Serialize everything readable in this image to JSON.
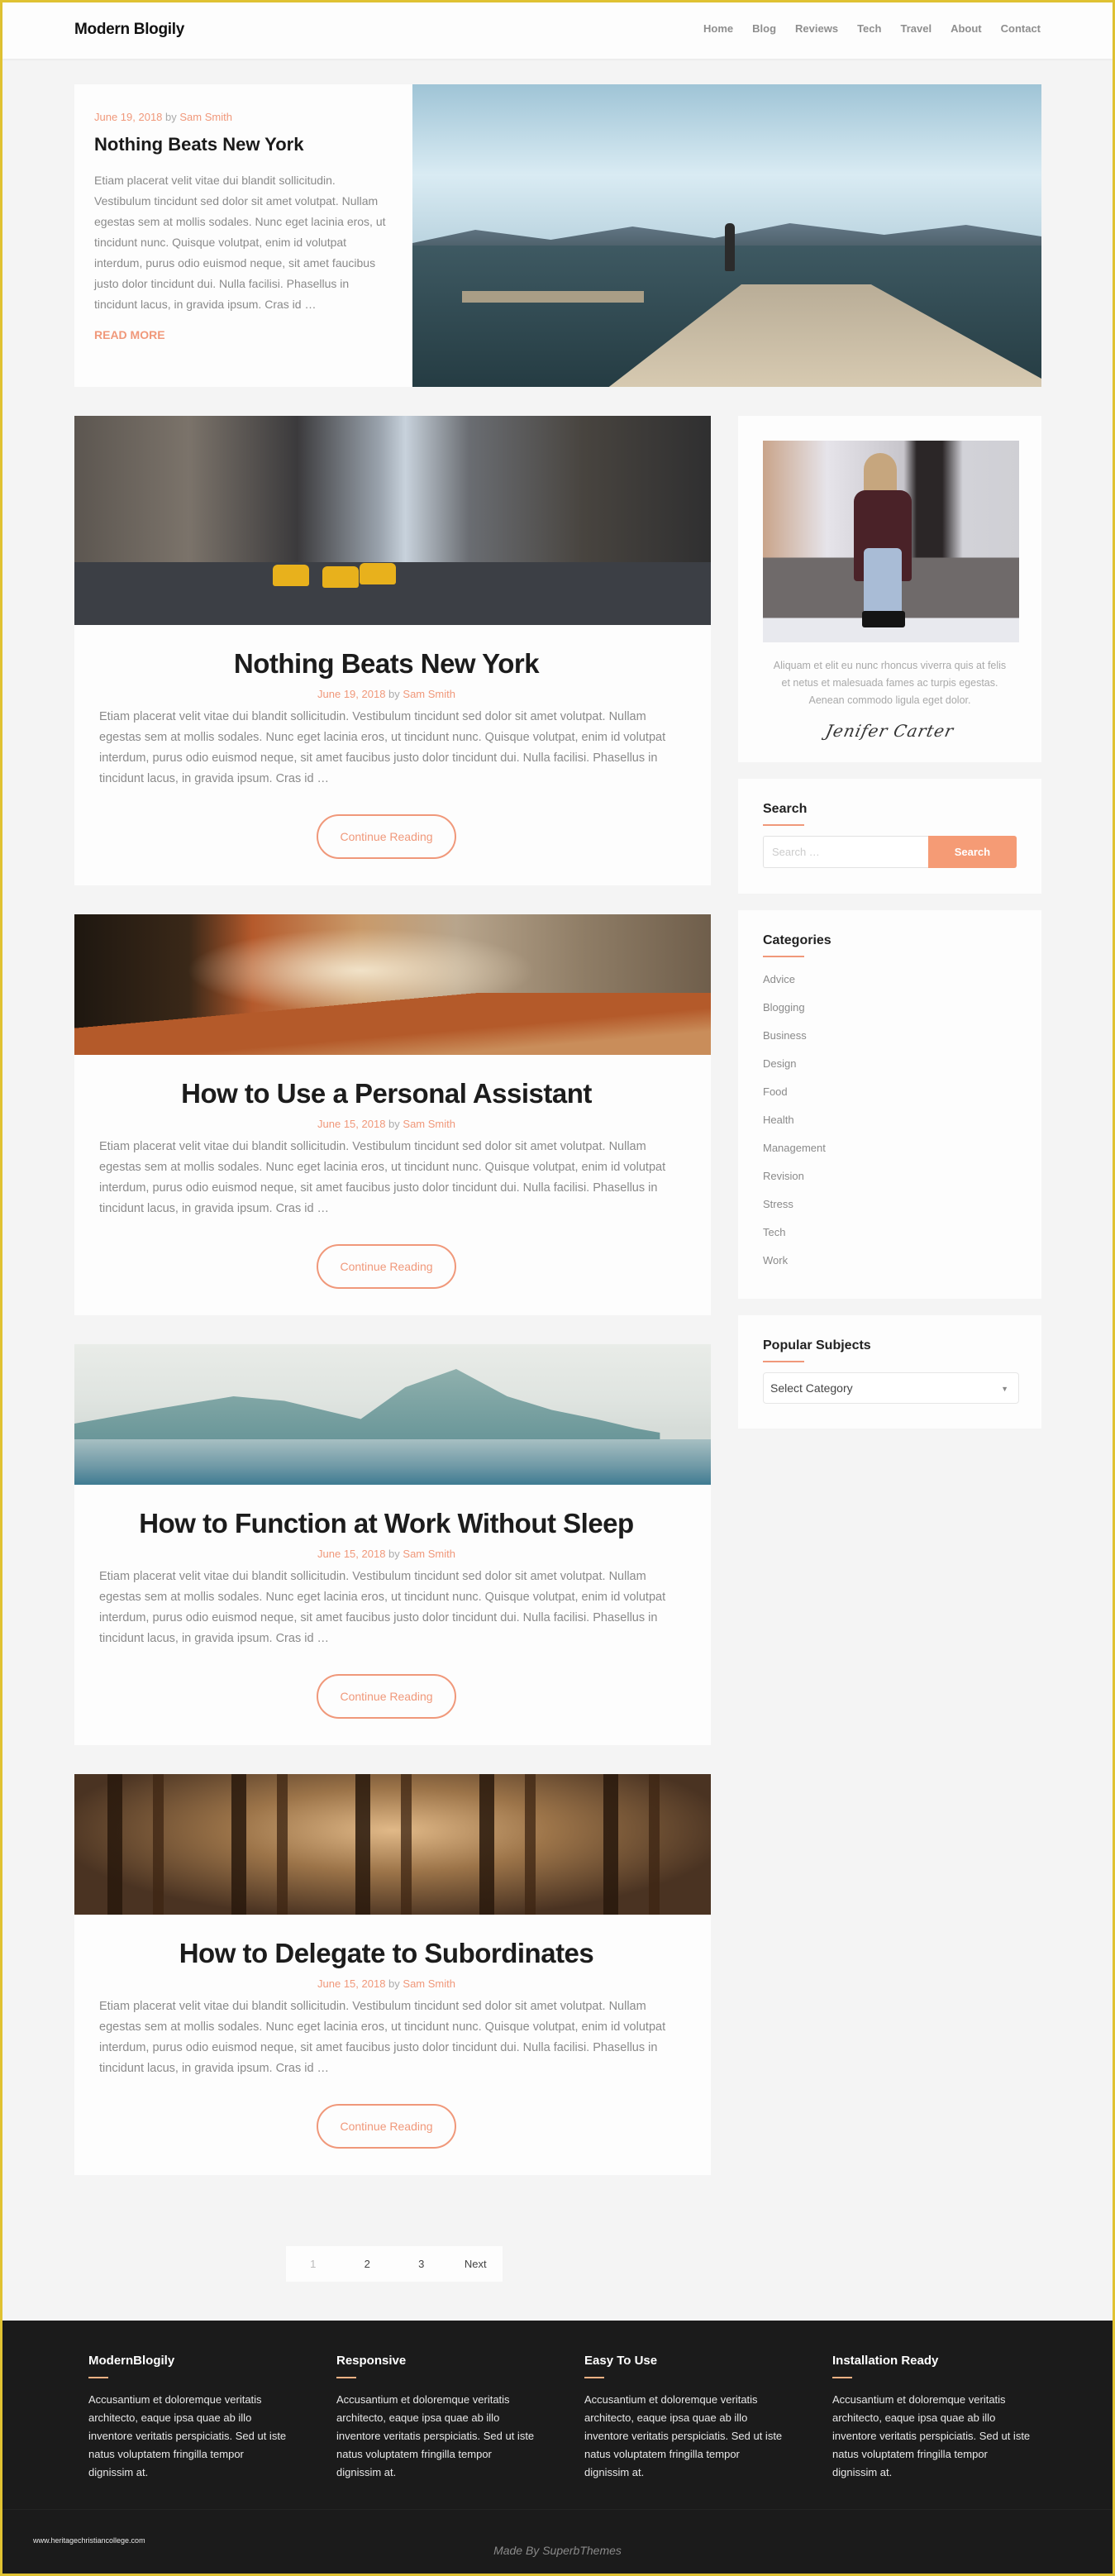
{
  "header": {
    "site_title": "Modern Blogily",
    "nav": [
      "Home",
      "Blog",
      "Reviews",
      "Tech",
      "Travel",
      "About",
      "Contact"
    ]
  },
  "featured": {
    "date": "June 19, 2018",
    "by": "by",
    "author": "Sam Smith",
    "title": "Nothing Beats New York",
    "excerpt": "Etiam placerat velit vitae dui blandit sollicitudin. Vestibulum tincidunt sed dolor sit amet volutpat. Nullam egestas sem at mollis sodales. Nunc eget lacinia eros, ut tincidunt nunc. Quisque volutpat, enim id volutpat interdum, purus odio euismod neque, sit amet faucibus justo dolor tincidunt dui. Nulla facilisi. Phasellus in tincidunt lacus, in gravida ipsum. Cras id …",
    "read_more": "READ MORE",
    "image": "lake-dock-photo"
  },
  "posts": [
    {
      "image": "city-street-photo",
      "title": "Nothing Beats New York",
      "date": "June 19, 2018",
      "by": "by",
      "author": "Sam Smith",
      "excerpt": "Etiam placerat velit vitae dui blandit sollicitudin. Vestibulum tincidunt sed dolor sit amet volutpat. Nullam egestas sem at mollis sodales. Nunc eget lacinia eros, ut tincidunt nunc. Quisque volutpat, enim id volutpat interdum, purus odio euismod neque, sit amet faucibus justo dolor tincidunt dui. Nulla facilisi. Phasellus in tincidunt lacus, in gravida ipsum. Cras id …",
      "button": "Continue Reading"
    },
    {
      "image": "autumn-forest-photo",
      "title": "How to Use a Personal Assistant",
      "date": "June 15, 2018",
      "by": "by",
      "author": "Sam Smith",
      "excerpt": "Etiam placerat velit vitae dui blandit sollicitudin. Vestibulum tincidunt sed dolor sit amet volutpat. Nullam egestas sem at mollis sodales. Nunc eget lacinia eros, ut tincidunt nunc. Quisque volutpat, enim id volutpat interdum, purus odio euismod neque, sit amet faucibus justo dolor tincidunt dui. Nulla facilisi. Phasellus in tincidunt lacus, in gravida ipsum. Cras id …",
      "button": "Continue Reading"
    },
    {
      "image": "coastal-mountains-photo",
      "title": "How to Function at Work Without Sleep",
      "date": "June 15, 2018",
      "by": "by",
      "author": "Sam Smith",
      "excerpt": "Etiam placerat velit vitae dui blandit sollicitudin. Vestibulum tincidunt sed dolor sit amet volutpat. Nullam egestas sem at mollis sodales. Nunc eget lacinia eros, ut tincidunt nunc. Quisque volutpat, enim id volutpat interdum, purus odio euismod neque, sit amet faucibus justo dolor tincidunt dui. Nulla facilisi. Phasellus in tincidunt lacus, in gravida ipsum. Cras id …",
      "button": "Continue Reading"
    },
    {
      "image": "redwood-forest-photo",
      "title": "How to Delegate to Subordinates",
      "date": "June 15, 2018",
      "by": "by",
      "author": "Sam Smith",
      "excerpt": "Etiam placerat velit vitae dui blandit sollicitudin. Vestibulum tincidunt sed dolor sit amet volutpat. Nullam egestas sem at mollis sodales. Nunc eget lacinia eros, ut tincidunt nunc. Quisque volutpat, enim id volutpat interdum, purus odio euismod neque, sit amet faucibus justo dolor tincidunt dui. Nulla facilisi. Phasellus in tincidunt lacus, in gravida ipsum. Cras id …",
      "button": "Continue Reading"
    }
  ],
  "pagination": {
    "pages": [
      "1",
      "2",
      "3"
    ],
    "current": "1",
    "next": "Next"
  },
  "sidebar": {
    "about": {
      "image": "woman-sitting-in-snow-photo",
      "text": "Aliquam et elit eu nunc rhoncus viverra quis at felis et netus et malesuada fames ac turpis egestas. Aenean commodo ligula eget dolor.",
      "signature": "Jenifer Carter"
    },
    "search": {
      "title": "Search",
      "placeholder": "Search …",
      "value": "",
      "button": "Search"
    },
    "categories": {
      "title": "Categories",
      "items": [
        "Advice",
        "Blogging",
        "Business",
        "Design",
        "Food",
        "Health",
        "Management",
        "Revision",
        "Stress",
        "Tech",
        "Work"
      ]
    },
    "popular": {
      "title": "Popular Subjects",
      "selected": "Select Category"
    }
  },
  "footer": {
    "columns": [
      {
        "title": "ModernBlogily",
        "text": "Accusantium et doloremque veritatis architecto, eaque ipsa quae ab illo inventore veritatis perspiciatis. Sed ut iste natus voluptatem fringilla tempor dignissim at."
      },
      {
        "title": "Responsive",
        "text": "Accusantium et doloremque veritatis architecto, eaque ipsa quae ab illo inventore veritatis perspiciatis. Sed ut iste natus voluptatem fringilla tempor dignissim at."
      },
      {
        "title": "Easy To Use",
        "text": "Accusantium et doloremque veritatis architecto, eaque ipsa quae ab illo inventore veritatis perspiciatis. Sed ut iste natus voluptatem fringilla tempor dignissim at."
      },
      {
        "title": "Installation Ready",
        "text": "Accusantium et doloremque veritatis architecto, eaque ipsa quae ab illo inventore veritatis perspiciatis. Sed ut iste natus voluptatem fringilla tempor dignissim at."
      }
    ],
    "watermark": "www.heritagechristiancollege.com",
    "credit": "Made By SuperbThemes"
  },
  "colors": {
    "accent": "#f0987a",
    "search_button": "#f59b75",
    "footer_bg": "#1b1b1b",
    "page_bg": "#f4f4f4",
    "frame_border": "#e0c232"
  }
}
